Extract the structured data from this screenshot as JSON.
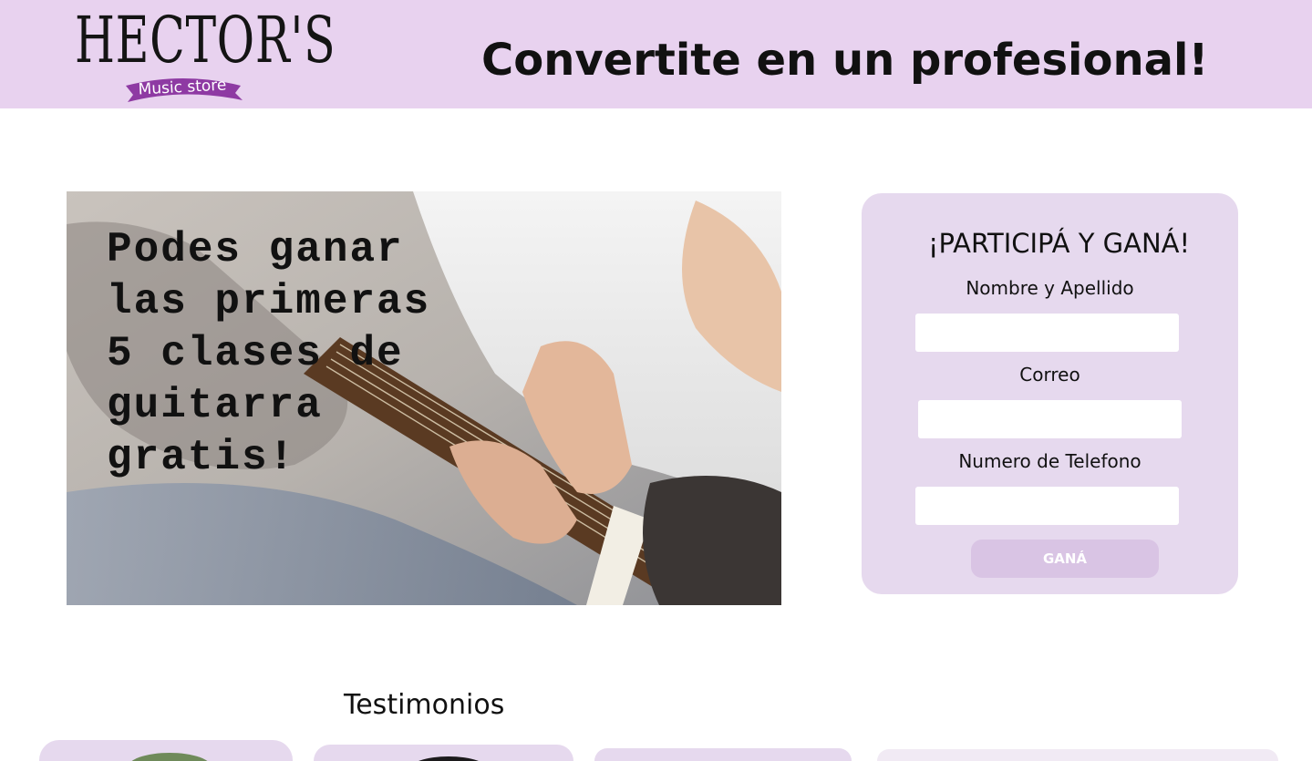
{
  "header": {
    "logo_title": "HECTOR'S",
    "logo_subtitle": "Music store",
    "title": "Convertite en un profesional!"
  },
  "hero": {
    "text": "Podes ganar\nlas primeras\n5 clases de\nguitarra\ngratis!"
  },
  "form": {
    "title": "¡PARTICIPÁ Y GANÁ!",
    "name_label": "Nombre y Apellido",
    "email_label": "Correo",
    "phone_label": "Numero de Telefono",
    "name_value": "",
    "email_value": "",
    "phone_value": "",
    "submit_label": "GANÁ"
  },
  "testimonials": {
    "title": "Testimonios"
  },
  "colors": {
    "header_bg": "#e8d2ef",
    "card_bg": "#e6d9ee",
    "button_bg": "#d9c4e4",
    "logo_ribbon": "#8e3aa3"
  }
}
